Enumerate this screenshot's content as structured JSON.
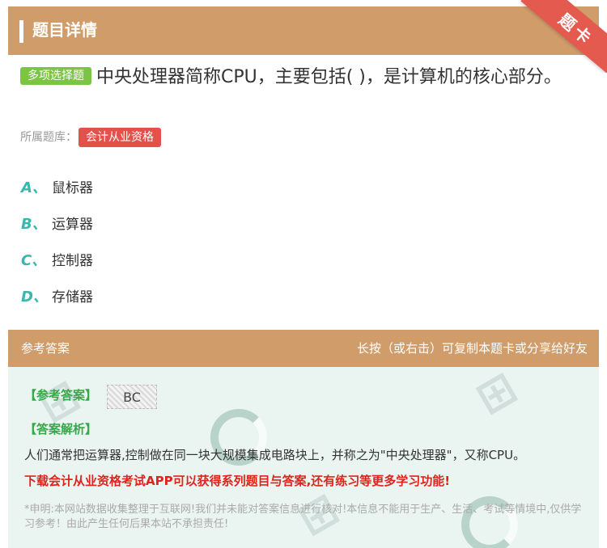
{
  "header": {
    "title": "题目详情",
    "ribbon_label": "题卡"
  },
  "question": {
    "type_badge": "多项选择题",
    "text": "中央处理器简称CPU，主要包括( )，是计算机的核心部分。"
  },
  "bank": {
    "label": "所属题库：",
    "tag": "会计从业资格"
  },
  "options": [
    {
      "letter": "A、",
      "text": "鼠标器"
    },
    {
      "letter": "B、",
      "text": "运算器"
    },
    {
      "letter": "C、",
      "text": "控制器"
    },
    {
      "letter": "D、",
      "text": "存储器"
    }
  ],
  "answer_bar": {
    "left": "参考答案",
    "right": "长按（或右击）可复制本题卡或分享给好友"
  },
  "answer": {
    "ref_label": "【参考答案】",
    "ref_value": "BC",
    "analysis_label": "【答案解析】",
    "analysis": "人们通常把运算器,控制做在同一块大规模集成电路块上，并称之为\"中央处理器\"，又称CPU。",
    "promo": "下载会计从业资格考试APP可以获得系列题目与答案,还有练习等更多学习功能!",
    "disclaimer": "*申明:本网站数据收集整理于互联网!我们并未能对答案信息进行核对!本信息不能用于生产、生活、考试等情境中,仅供学习参考！由此产生任何后果本站不承担责任!"
  },
  "colors": {
    "header": "#cf9c6a",
    "ribbon": "#e45a4e",
    "option_letter": "#36b8ae",
    "badge_green": "#7cc443",
    "tag_red": "#e4504a",
    "panel": "#eaf4f1",
    "promo": "#e0231c"
  }
}
